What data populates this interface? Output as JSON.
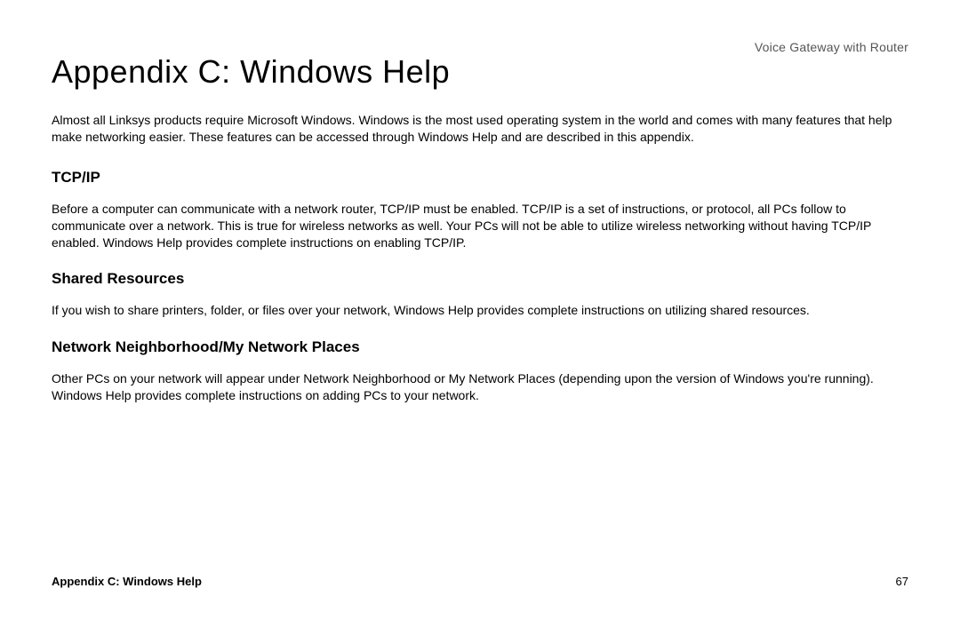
{
  "header": {
    "product": "Voice Gateway with Router"
  },
  "title": "Appendix C: Windows Help",
  "intro": "Almost all Linksys products require Microsoft Windows. Windows is the most used operating system in the world and comes with many features that help make networking easier. These features can be accessed through Windows Help and are described in this appendix.",
  "sections": [
    {
      "heading": "TCP/IP",
      "body": "Before a computer can communicate with a network router, TCP/IP must be enabled. TCP/IP is a set of instructions, or protocol, all PCs follow to communicate over a network. This is true for wireless networks as well. Your PCs will not be able to utilize wireless networking without having TCP/IP enabled. Windows Help provides complete instructions on enabling TCP/IP."
    },
    {
      "heading": "Shared Resources",
      "body": "If you wish to share printers, folder, or files over your network, Windows Help provides complete instructions on utilizing shared resources."
    },
    {
      "heading": "Network Neighborhood/My Network Places",
      "body": "Other PCs on your network will appear under Network Neighborhood or My Network Places (depending upon the version of Windows you're running). Windows Help provides complete instructions on adding PCs to your network."
    }
  ],
  "footer": {
    "left": "Appendix C: Windows Help",
    "page_number": "67"
  }
}
